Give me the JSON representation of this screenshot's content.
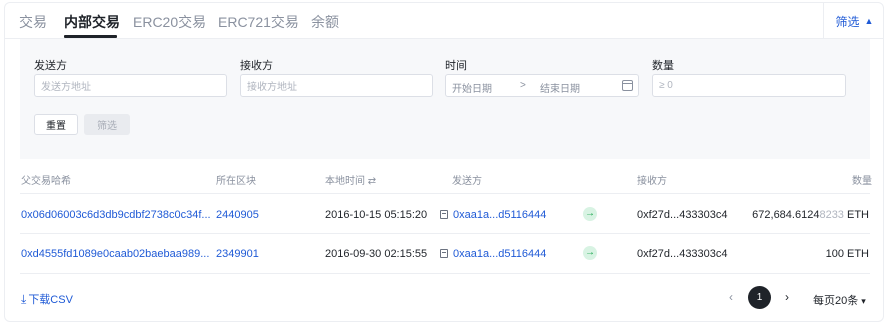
{
  "tabs": [
    {
      "label": "交易"
    },
    {
      "label": "内部交易"
    },
    {
      "label": "ERC20交易"
    },
    {
      "label": "ERC721交易"
    },
    {
      "label": "余额"
    }
  ],
  "filter_toggle": {
    "label": "筛选",
    "icon": "chevron-up-icon"
  },
  "filters": {
    "from": {
      "label": "发送方",
      "placeholder": "发送方地址"
    },
    "to": {
      "label": "接收方",
      "placeholder": "接收方地址"
    },
    "time": {
      "label": "时间",
      "start_placeholder": "开始日期",
      "separator": ">",
      "end_placeholder": "结束日期",
      "icon": "calendar-icon"
    },
    "amount": {
      "label": "数量",
      "placeholder": "≥ 0"
    },
    "reset_label": "重置",
    "apply_label": "筛选"
  },
  "table": {
    "columns": [
      "父交易哈希",
      "所在区块",
      "本地时间 ⇄",
      "发送方",
      "接收方",
      "数量"
    ],
    "rows": [
      {
        "hash": "0x06d06003c6d3db9cdbf2738c0c34f...",
        "block": "2440905",
        "time": "2016-10-15 05:15:20",
        "from": "0xaa1a...d5116444",
        "to": "0xf27d...433303c4",
        "amount_main": "672,684.6124",
        "amount_dim": "8233",
        "amount_unit": " ETH"
      },
      {
        "hash": "0xd4555fd1089e0caab02baebaa989...",
        "block": "2349901",
        "time": "2016-09-30 02:15:55",
        "from": "0xaa1a...d5116444",
        "to": "0xf27d...433303c4",
        "amount_main": "100",
        "amount_dim": "",
        "amount_unit": " ETH"
      }
    ]
  },
  "footer": {
    "download_label": "下载CSV",
    "download_icon": "download-icon",
    "current_page": "1",
    "prev_icon": "‹",
    "next_icon": "›",
    "per_page_label": "每页20条"
  },
  "colors": {
    "link": "#1f5ad6",
    "active_tab": "#1f2329",
    "arrow_badge": "#16a34a"
  }
}
